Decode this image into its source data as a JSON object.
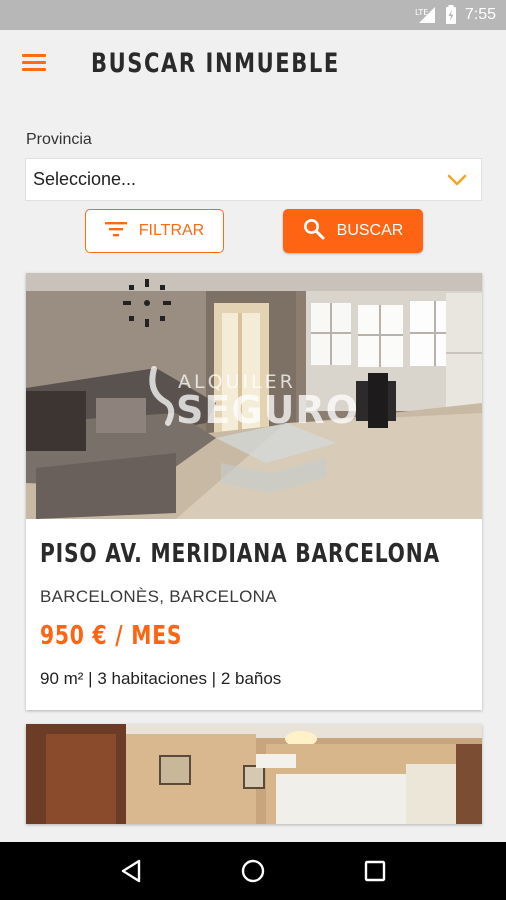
{
  "status_bar": {
    "network": "LTE",
    "time": "7:55"
  },
  "header": {
    "title": "BUSCAR INMUEBLE",
    "menu_icon": "menu-icon"
  },
  "filters": {
    "province_label": "Provincia",
    "province_select": {
      "value": "Seleccione..."
    },
    "filter_button": "FILTRAR",
    "search_button": "BUSCAR"
  },
  "listings": [
    {
      "title": "PISO AV. MERIDIANA BARCELONA",
      "location": "BARCELONÈS, BARCELONA",
      "price": "950 € / MES",
      "features": "90  m² | 3 habitaciones | 2 baños",
      "watermark_top": "ALQUILER",
      "watermark_bottom": "SEGURO"
    }
  ],
  "colors": {
    "accent": "#ff6412",
    "title": "#2a2a2a",
    "status_bar": "#b7b7b7",
    "background": "#f0f0f0"
  }
}
